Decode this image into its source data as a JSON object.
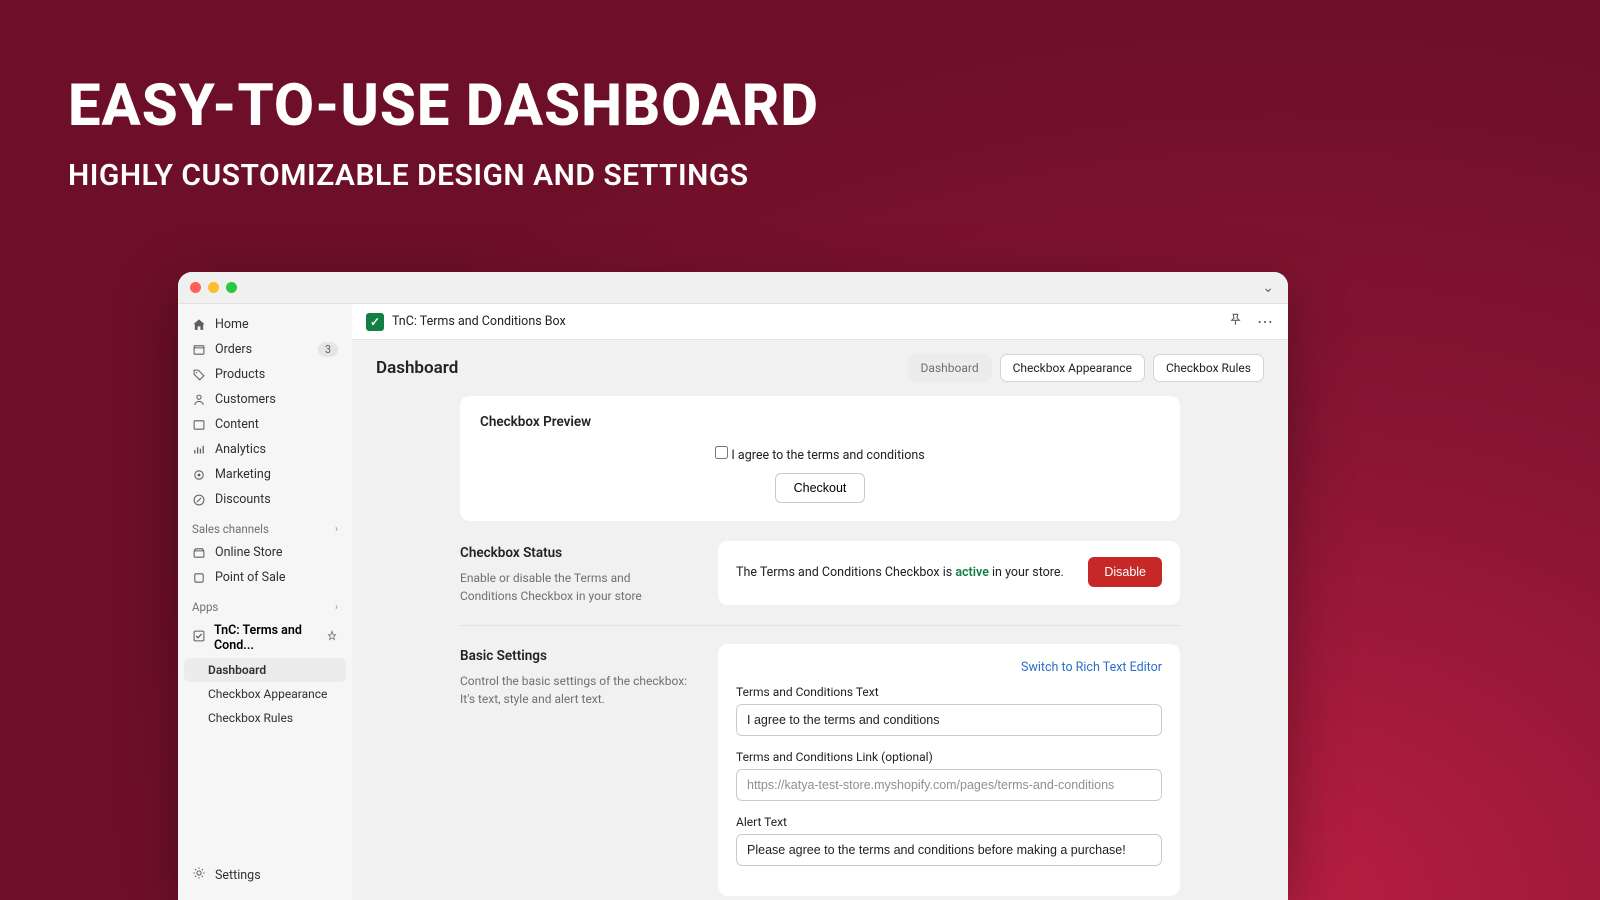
{
  "marketing": {
    "title": "EASY-TO-USE DASHBOARD",
    "subtitle": "HIGHLY CUSTOMIZABLE DESIGN AND SETTINGS"
  },
  "sidebar": {
    "items": [
      {
        "label": "Home"
      },
      {
        "label": "Orders",
        "badge": "3"
      },
      {
        "label": "Products"
      },
      {
        "label": "Customers"
      },
      {
        "label": "Content"
      },
      {
        "label": "Analytics"
      },
      {
        "label": "Marketing"
      },
      {
        "label": "Discounts"
      }
    ],
    "salesChannelsHeader": "Sales channels",
    "salesChannels": [
      {
        "label": "Online Store"
      },
      {
        "label": "Point of Sale"
      }
    ],
    "appsHeader": "Apps",
    "app": {
      "label": "TnC: Terms and Cond..."
    },
    "appSub": [
      {
        "label": "Dashboard",
        "active": true
      },
      {
        "label": "Checkbox Appearance"
      },
      {
        "label": "Checkbox Rules"
      }
    ],
    "settings": "Settings"
  },
  "topbar": {
    "title": "TnC: Terms and Conditions Box"
  },
  "page": {
    "title": "Dashboard",
    "tabs": [
      {
        "label": "Dashboard",
        "active": true
      },
      {
        "label": "Checkbox Appearance"
      },
      {
        "label": "Checkbox Rules"
      }
    ]
  },
  "previewCard": {
    "title": "Checkbox Preview",
    "checkboxLabel": "I agree to the terms and conditions",
    "buttonLabel": "Checkout"
  },
  "statusSection": {
    "title": "Checkbox Status",
    "desc": "Enable or disable the Terms and Conditions Checkbox in your store",
    "statusPrefix": "The Terms and Conditions Checkbox is ",
    "statusWord": "active",
    "statusSuffix": " in your store.",
    "disableLabel": "Disable"
  },
  "basicSection": {
    "title": "Basic Settings",
    "desc": "Control the basic settings of the checkbox: It's text, style and alert text.",
    "switchLink": "Switch to Rich Text Editor",
    "field1Label": "Terms and Conditions Text",
    "field1Value": "I agree to the terms and conditions",
    "field2Label": "Terms and Conditions Link (optional)",
    "field2Placeholder": "https://katya-test-store.myshopify.com/pages/terms-and-conditions",
    "field3Label": "Alert Text",
    "field3Value": "Please agree to the terms and conditions before making a purchase!"
  }
}
